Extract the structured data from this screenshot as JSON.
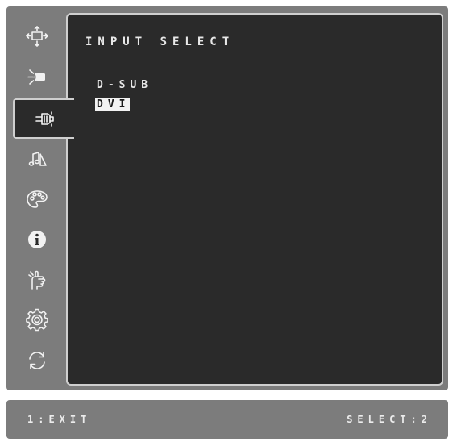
{
  "menu": {
    "title": "INPUT SELECT",
    "active_index": 2,
    "sidebar_icons": [
      "auto-image-adjust-icon",
      "contrast-brightness-icon",
      "input-select-icon",
      "audio-adjust-icon",
      "color-adjust-icon",
      "information-icon",
      "manual-image-adjust-icon",
      "setup-menu-icon",
      "memory-recall-icon"
    ],
    "options": [
      {
        "label": "D-SUB",
        "selected": false
      },
      {
        "label": "DVI",
        "selected": true
      }
    ]
  },
  "footer": {
    "left": "1:EXIT",
    "right": "SELECT:2"
  },
  "colors": {
    "frame": "#7c7c7c",
    "panel": "#2a2a2a",
    "text": "#e8e8e8",
    "highlight": "#f2f2f2"
  }
}
